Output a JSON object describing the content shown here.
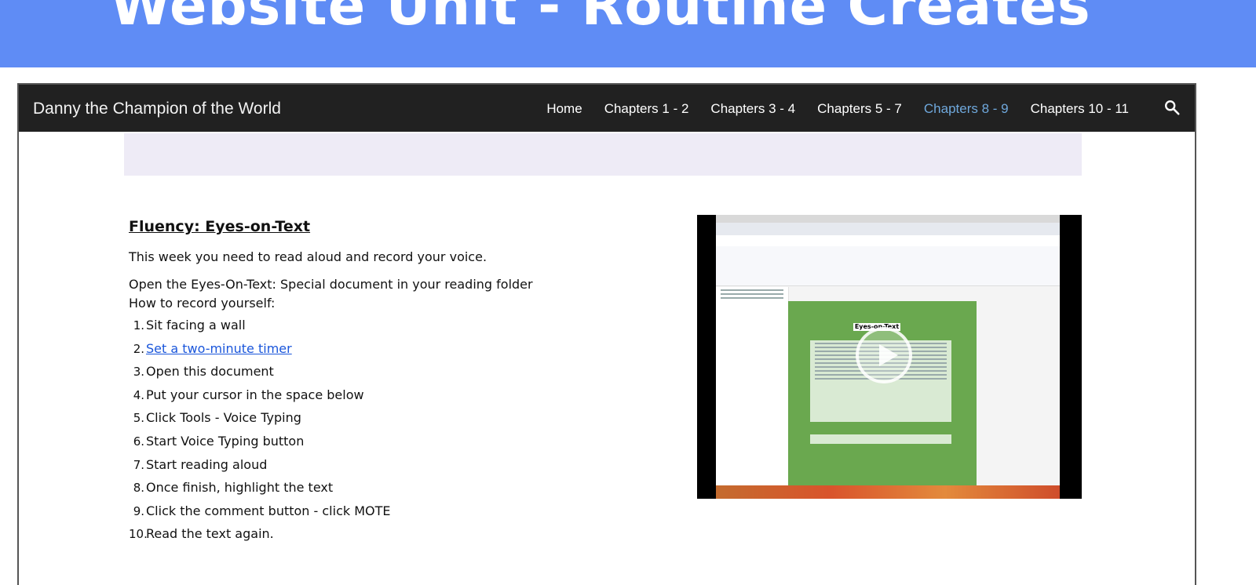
{
  "banner": {
    "title": "Website Unit - Routine Creates"
  },
  "site": {
    "title": "Danny the Champion of the World"
  },
  "nav": {
    "items": [
      {
        "label": "Home"
      },
      {
        "label": "Chapters 1 - 2"
      },
      {
        "label": "Chapters 3 - 4"
      },
      {
        "label": "Chapters 5 - 7"
      },
      {
        "label": "Chapters 8 - 9",
        "active": true
      },
      {
        "label": "Chapters 10 - 11"
      }
    ],
    "search_icon": "search-icon"
  },
  "content": {
    "heading": "Fluency: Eyes-on-Text",
    "intro": "This week you need to read aloud and record your voice.",
    "open_doc": "Open the Eyes-On-Text: Special  document in your reading folder",
    "how_to": "How to record yourself:",
    "steps": [
      {
        "num": "1.",
        "text": " Sit facing a wall"
      },
      {
        "num": "2.",
        "text": "Set a two-minute timer",
        "link": true
      },
      {
        "num": "3.",
        "text": "Open this document"
      },
      {
        "num": "4.",
        "text": "Put your cursor in the space below"
      },
      {
        "num": "5.",
        "text": "Click Tools - Voice Typing"
      },
      {
        "num": "6.",
        "text": "Start Voice Typing button"
      },
      {
        "num": "7.",
        "text": "Start reading aloud"
      },
      {
        "num": "8.",
        "text": "Once finish, highlight the text"
      },
      {
        "num": "9.",
        "text": "Click the comment button - click MOTE"
      },
      {
        "num": "10.",
        "text": "Read the text again."
      }
    ]
  },
  "video": {
    "doc_title": "Eyes-on-Text",
    "play_icon": "play-icon"
  },
  "colors": {
    "banner": "#5f8cf5",
    "navbar": "#212121",
    "nav_active": "#6fa8dc",
    "link": "#1a56db"
  }
}
